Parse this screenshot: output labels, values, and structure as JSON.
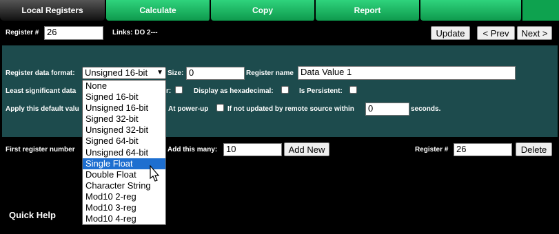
{
  "tabs": [
    {
      "label": "Local Registers",
      "active": true
    },
    {
      "label": "Calculate"
    },
    {
      "label": "Copy"
    },
    {
      "label": "Report"
    },
    {
      "label": ""
    }
  ],
  "header": {
    "register_label": "Register #",
    "register_value": "26",
    "links_text": "Links: DO 2---",
    "update_label": "Update",
    "prev_label": "< Prev",
    "next_label": "Next >"
  },
  "form": {
    "format_label": "Register data format:",
    "format_value": "Unsigned 16-bit",
    "size_label": "Size:",
    "size_value": "0",
    "name_label": "Register name",
    "name_value": "Data Value 1",
    "lsd_label": "Least significant data",
    "lsd_hidden_suffix": "r:",
    "hex_label": "Display as hexadecimal:",
    "persistent_label": "Is Persistent:",
    "apply_label": "Apply this default valu",
    "powerup_label": "At power-up",
    "not_updated_label": "If not updated by remote source within",
    "seconds_value": "0",
    "seconds_label": "seconds."
  },
  "dropdown": {
    "options": [
      "None",
      "Signed 16-bit",
      "Unsigned 16-bit",
      "Signed 32-bit",
      "Unsigned 32-bit",
      "Signed 64-bit",
      "Unsigned 64-bit",
      "Single Float",
      "Double Float",
      "Character String",
      "Mod10 2-reg",
      "Mod10 3-reg",
      "Mod10 4-reg"
    ],
    "highlighted": "Single Float"
  },
  "add_row": {
    "first_label": "First register number",
    "add_many_label": "Add this many:",
    "add_many_value": "10",
    "add_new_label": "Add New",
    "register_label": "Register #",
    "register_value": "26",
    "delete_label": "Delete"
  },
  "help": {
    "title": "Quick Help"
  },
  "colors": {
    "tab_green": "#18b560",
    "panel": "#1d4b4d",
    "highlight": "#1e6fd0"
  }
}
